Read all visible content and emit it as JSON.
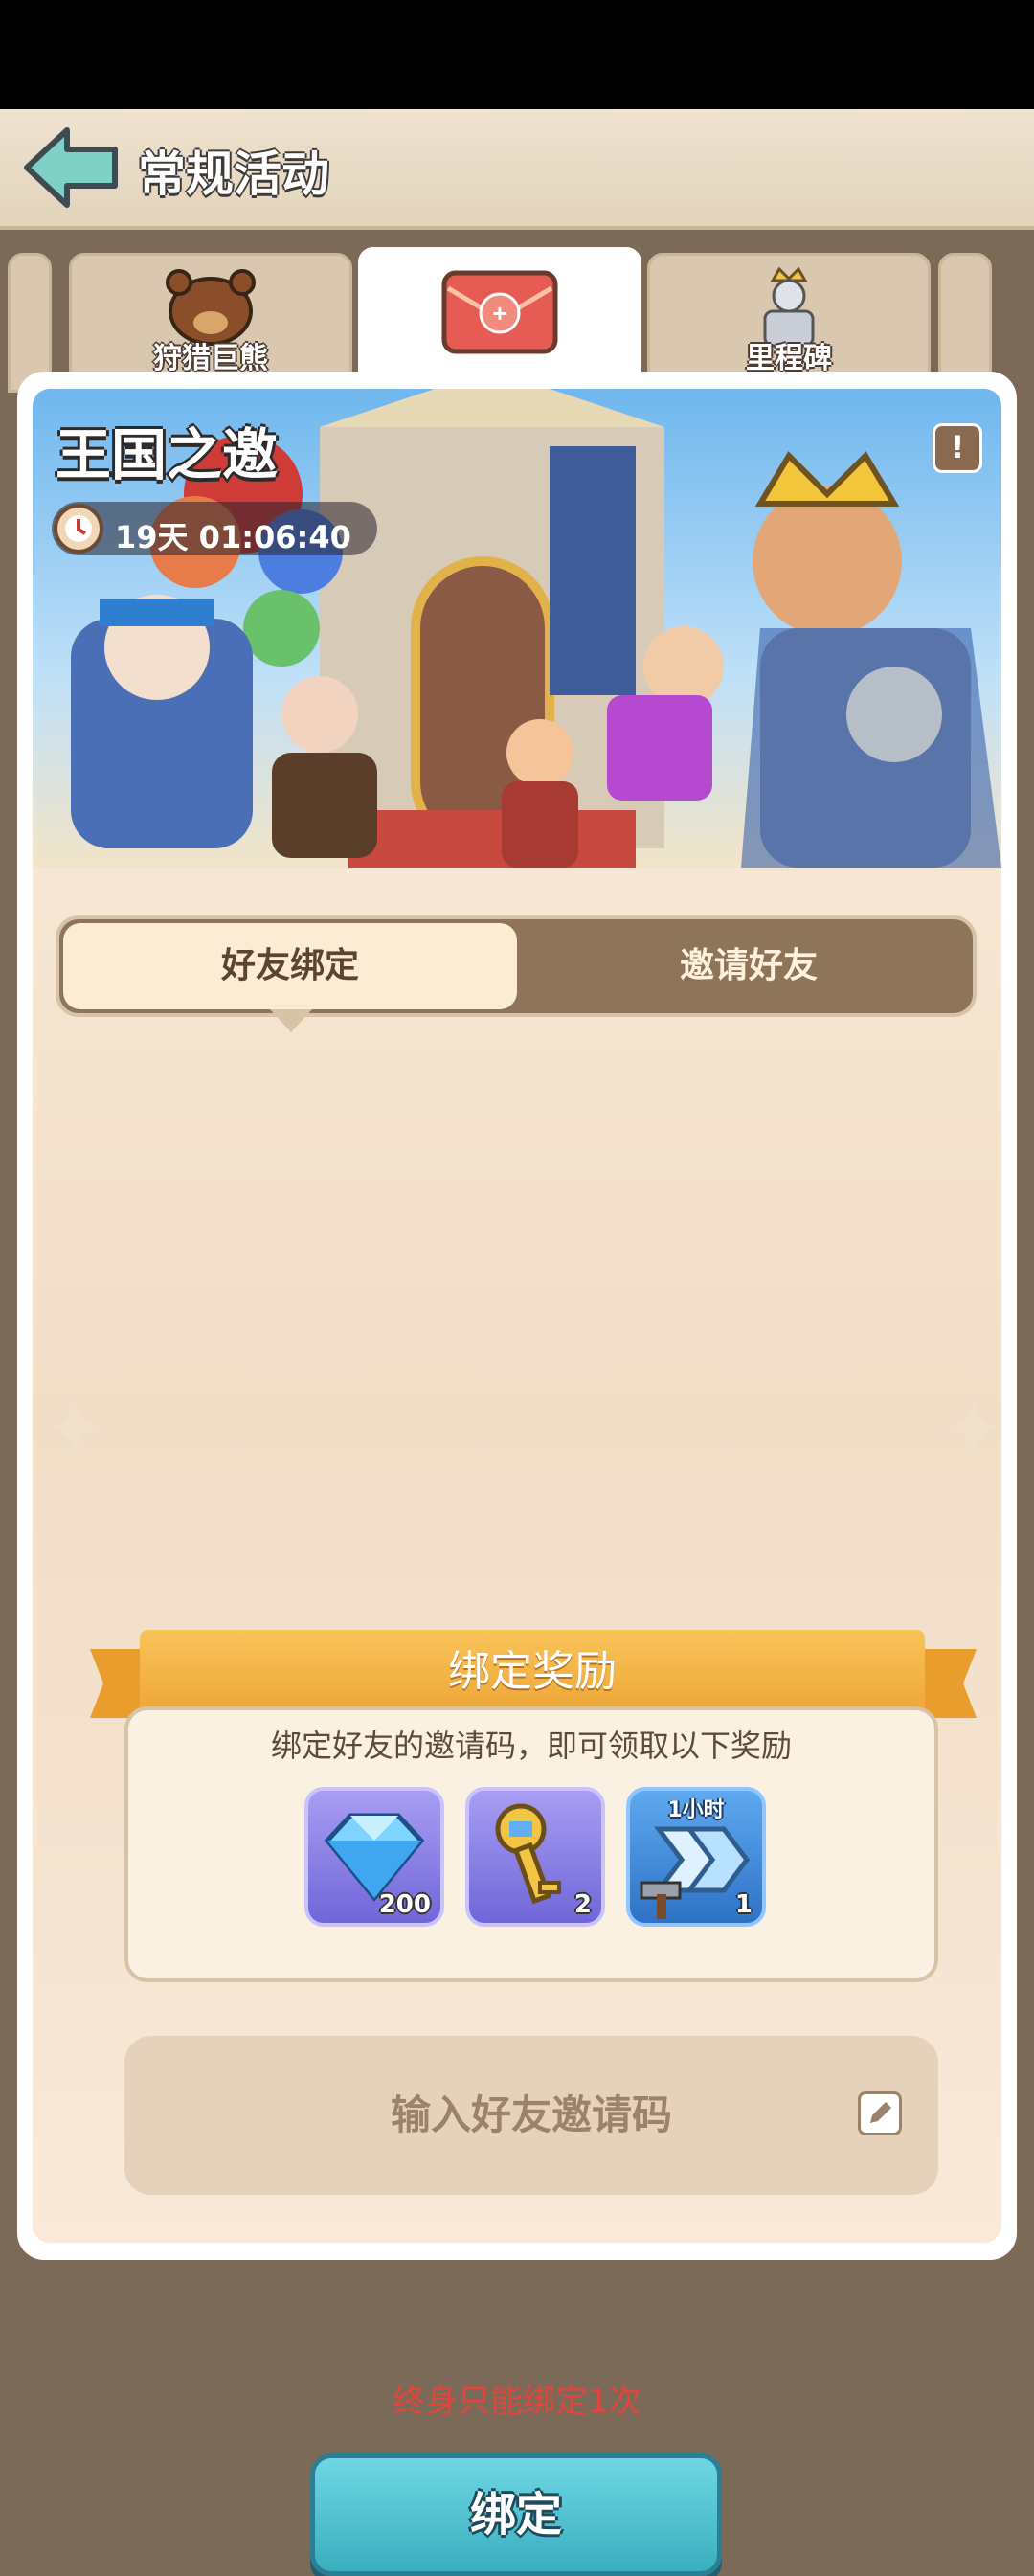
{
  "header": {
    "title": "常规活动"
  },
  "tabs": [
    {
      "label": "狩猎巨熊",
      "icon": "bear-icon"
    },
    {
      "label": "",
      "icon": "invite-friends-icon",
      "active": true
    },
    {
      "label": "里程碑",
      "icon": "statue-icon"
    }
  ],
  "banner": {
    "title": "王国之邀",
    "timer": "19天 01:06:40",
    "info": "!"
  },
  "segmented": {
    "left": "好友绑定",
    "right": "邀请好友"
  },
  "reward": {
    "title": "绑定奖励",
    "description": "绑定好友的邀请码，即可领取以下奖励",
    "items": [
      {
        "icon": "diamond-icon",
        "count": "200",
        "top": ""
      },
      {
        "icon": "key-icon",
        "count": "2",
        "top": ""
      },
      {
        "icon": "speedup-icon",
        "count": "1",
        "top": "1小时"
      }
    ]
  },
  "input": {
    "placeholder": "输入好友邀请码"
  },
  "limit_note": "终身只能绑定1次",
  "bind_button": "绑定",
  "colors": {
    "accent": "#39aebe",
    "warning": "#e0463d",
    "ribbon": "#eea536"
  }
}
